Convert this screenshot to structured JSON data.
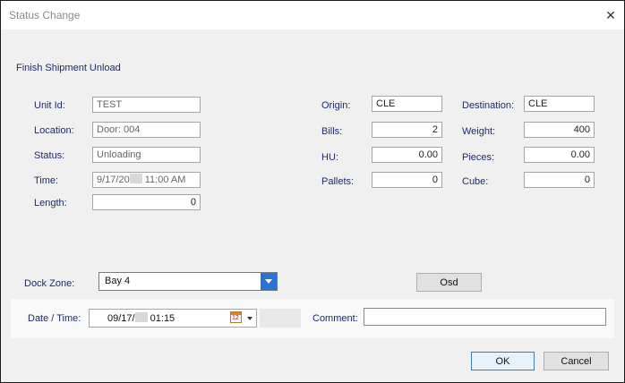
{
  "window": {
    "title": "Status Change"
  },
  "section_title": "Finish Shipment Unload",
  "fields": {
    "unit_id": {
      "label": "Unit Id:",
      "value": "TEST"
    },
    "location": {
      "label": "Location:",
      "value": "Door: 004"
    },
    "status": {
      "label": "Status:",
      "value": "Unloading"
    },
    "time": {
      "label": "Time:",
      "value_prefix": "9/17/20",
      "value_suffix": " 11:00 AM"
    },
    "length": {
      "label": "Length:",
      "value": "0"
    },
    "origin": {
      "label": "Origin:",
      "value": "CLE"
    },
    "bills": {
      "label": "Bills:",
      "value": "2"
    },
    "hu": {
      "label": "HU:",
      "value": "0.00"
    },
    "pallets": {
      "label": "Pallets:",
      "value": "0"
    },
    "destination": {
      "label": "Destination:",
      "value": "CLE"
    },
    "weight": {
      "label": "Weight:",
      "value": "400"
    },
    "pieces": {
      "label": "Pieces:",
      "value": "0.00"
    },
    "cube": {
      "label": "Cube:",
      "value": "0"
    }
  },
  "dock_zone": {
    "label": "Dock Zone:",
    "value": "Bay 4"
  },
  "osd_button": "Osd",
  "date_time": {
    "label": "Date / Time:",
    "value_prefix": "09/17/",
    "value_suffix": " 01:15",
    "calendar_day": "12"
  },
  "comment": {
    "label": "Comment:",
    "value": ""
  },
  "ok_button": "OK",
  "cancel_button": "Cancel",
  "colors": {
    "label_text": "#1f2a66",
    "dropdown_button": "#2a73d6",
    "focus_border": "#3c7fb1"
  },
  "icons": [
    "close-icon",
    "calendar-icon",
    "chevron-down-icon"
  ]
}
